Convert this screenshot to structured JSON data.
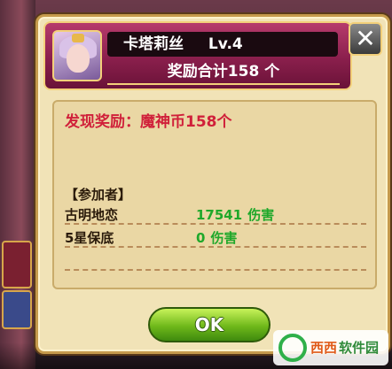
{
  "header": {
    "character_name": "卡塔莉丝",
    "level": "Lv.4",
    "reward_total": "奖励合计158 个"
  },
  "close_button": {
    "label": "✕"
  },
  "content": {
    "found_label": "发现奖励：",
    "found_value": "魔神币158个",
    "participants_title": "【参加者】",
    "participants": [
      {
        "name": "古明地恋",
        "damage": "17541",
        "unit": "伤害"
      },
      {
        "name": "5星保底",
        "damage": "0",
        "unit": "伤害"
      }
    ]
  },
  "ok_button": {
    "label": "OK"
  },
  "watermark": {
    "text_a": "西西",
    "text_b": "软件园"
  },
  "colors": {
    "header_bg": "#8a1f4c",
    "panel_bg": "#f1e3b7",
    "reward_red": "#d0203a",
    "damage_green": "#1fa82a",
    "ok_green": "#6fb81a"
  }
}
